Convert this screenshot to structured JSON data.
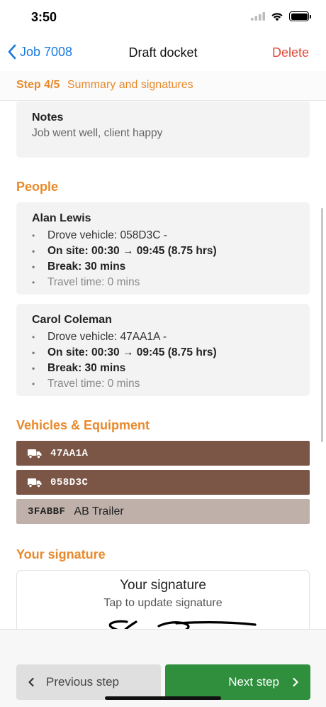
{
  "status": {
    "time": "3:50"
  },
  "nav": {
    "back_label": "Job 7008",
    "title": "Draft docket",
    "delete_label": "Delete"
  },
  "step": {
    "number": "Step 4/5",
    "label": "Summary and signatures"
  },
  "notes": {
    "title": "Notes",
    "text": "Job went well, client happy"
  },
  "people": {
    "heading": "People",
    "items": [
      {
        "name": "Alan Lewis",
        "vehicle": "Drove vehicle: 058D3C -",
        "on_site": "On site: 00:30 → 09:45 (8.75 hrs)",
        "break": "Break: 30 mins",
        "travel": "Travel time: 0 mins"
      },
      {
        "name": "Carol Coleman",
        "vehicle": "Drove vehicle: 47AA1A -",
        "on_site": "On site: 00:30 → 09:45 (8.75 hrs)",
        "break": "Break: 30 mins",
        "travel": "Travel time: 0 mins"
      }
    ]
  },
  "vehicles": {
    "heading": "Vehicles & Equipment",
    "items": [
      {
        "code": "47AA1A",
        "name": "",
        "icon": "truck-icon"
      },
      {
        "code": "058D3C",
        "name": "",
        "icon": "truck-icon"
      },
      {
        "code": "3FABBF",
        "name": "AB Trailer",
        "icon": ""
      }
    ]
  },
  "signature": {
    "heading": "Your signature",
    "title": "Your signature",
    "subtitle": "Tap to update signature"
  },
  "footer": {
    "prev_label": "Previous step",
    "next_label": "Next step"
  },
  "colors": {
    "accent": "#e8892b",
    "link": "#1a7ae0",
    "delete": "#e04a3a",
    "vehicle_dark": "#7b5646",
    "vehicle_light": "#bfb0aa",
    "next_button": "#2f8f3d"
  }
}
